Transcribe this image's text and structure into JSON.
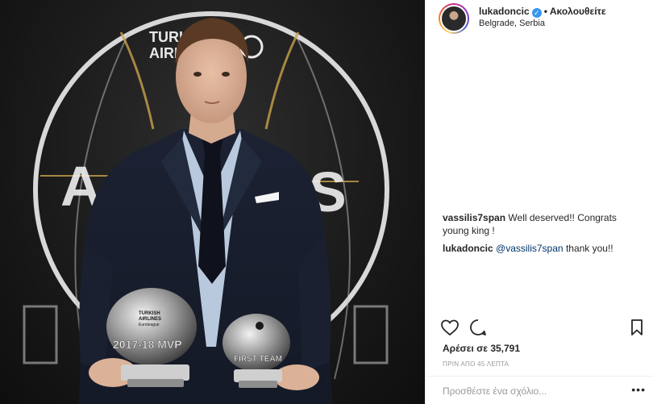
{
  "post": {
    "username": "lukadoncic",
    "follow_label": "Ακολουθείτε",
    "separator": "•",
    "location": "Belgrade, Serbia",
    "comments": [
      {
        "user": "vassilis7span",
        "text": "Well deserved!! Congrats young king !"
      },
      {
        "user": "lukadoncic",
        "mention": "@vassilis7span",
        "text": "thank you!!"
      }
    ],
    "likes_label": "Αρέσει σε 35,791",
    "time_ago": "ΠΡΙΝ ΑΠΟ 45 ΛΕΠΤΑ",
    "comment_placeholder": "Προσθέστε ένα σχόλιο...",
    "more_label": "•••"
  },
  "photo": {
    "backdrop_text": {
      "sponsor_line1": "TURKISH",
      "sponsor_line2": "AIRLINES",
      "awards_left": "A",
      "awards_right": "S"
    },
    "trophy_left": {
      "brand_line1": "TURKISH",
      "brand_line2": "AIRLINES",
      "brand_line3": "Euroleague",
      "caption": "2017-18 MVP"
    },
    "trophy_right": {
      "caption": "FIRST TEAM"
    }
  },
  "icons": {
    "heart": "heart-icon",
    "comment": "comment-icon",
    "bookmark": "bookmark-icon",
    "verified": "verified-badge-icon",
    "more": "more-options-icon"
  },
  "colors": {
    "link": "#003569",
    "verified": "#3897f0",
    "muted": "#999999",
    "text": "#262626"
  }
}
